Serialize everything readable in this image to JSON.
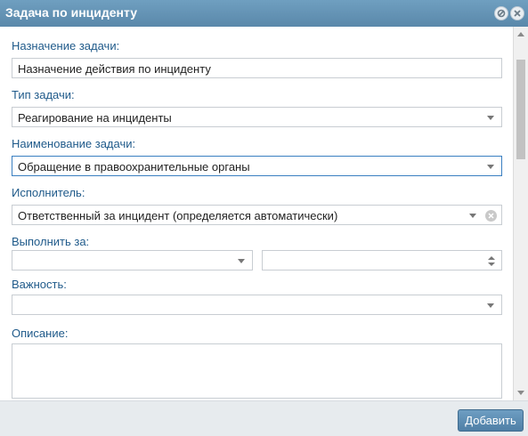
{
  "dialog": {
    "title": "Задача по инциденту"
  },
  "form": {
    "purpose": {
      "label": "Назначение задачи:",
      "value": "Назначение действия по инциденту"
    },
    "task_type": {
      "label": "Тип задачи:",
      "value": "Реагирование на инциденты"
    },
    "task_name": {
      "label": "Наименование задачи:",
      "value": "Обращение в правоохранительные органы"
    },
    "assignee": {
      "label": "Исполнитель:",
      "value": "Ответственный за инцидент (определяется автоматически)"
    },
    "deadline": {
      "label": "Выполнить за:",
      "unit_value": "",
      "amount_value": ""
    },
    "priority": {
      "label": "Важность:",
      "value": ""
    },
    "description": {
      "label": "Описание:",
      "value": ""
    }
  },
  "footer": {
    "add_label": "Добавить"
  },
  "colors": {
    "titlebar": "#5a88aa",
    "label": "#1f5a8a",
    "button": "#4f7fa6"
  },
  "icons": {
    "minimize": "minimize-icon",
    "close": "close-icon",
    "dropdown": "chevron-down-icon",
    "clear": "clear-icon",
    "spinner": "spinner-icon"
  }
}
